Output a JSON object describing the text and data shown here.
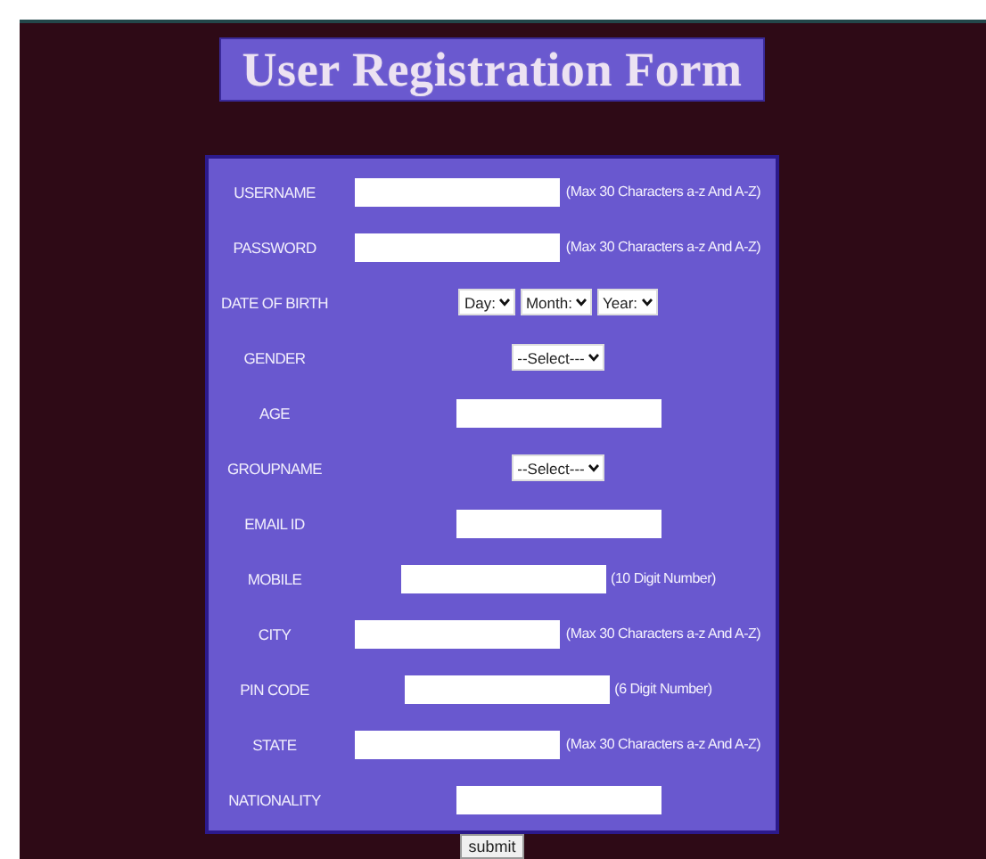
{
  "title": "User Registration Form",
  "fields": [
    {
      "kind": "text",
      "label": "USERNAME",
      "hint": "(Max 30 Characters a-z And A-Z)"
    },
    {
      "kind": "text",
      "label": "PASSWORD",
      "hint": "(Max 30 Characters a-z And A-Z)"
    },
    {
      "kind": "selects",
      "label": "DATE OF BIRTH",
      "options": [
        "Day:",
        "Month:",
        "Year:"
      ]
    },
    {
      "kind": "selects",
      "label": "GENDER",
      "options": [
        "--Select---"
      ]
    },
    {
      "kind": "text",
      "label": "AGE"
    },
    {
      "kind": "selects",
      "label": "GROUPNAME",
      "options": [
        "--Select---"
      ]
    },
    {
      "kind": "text",
      "label": "EMAIL ID"
    },
    {
      "kind": "text",
      "label": "MOBILE",
      "hint": "(10 Digit Number)"
    },
    {
      "kind": "text",
      "label": "CITY",
      "hint": "(Max 30 Characters a-z And A-Z)"
    },
    {
      "kind": "text",
      "label": "PIN CODE",
      "hint": "(6 Digit Number)"
    },
    {
      "kind": "text",
      "label": "STATE",
      "hint": "(Max 30 Characters a-z And A-Z)"
    },
    {
      "kind": "text",
      "label": "NATIONALITY"
    }
  ],
  "submit": "submit"
}
